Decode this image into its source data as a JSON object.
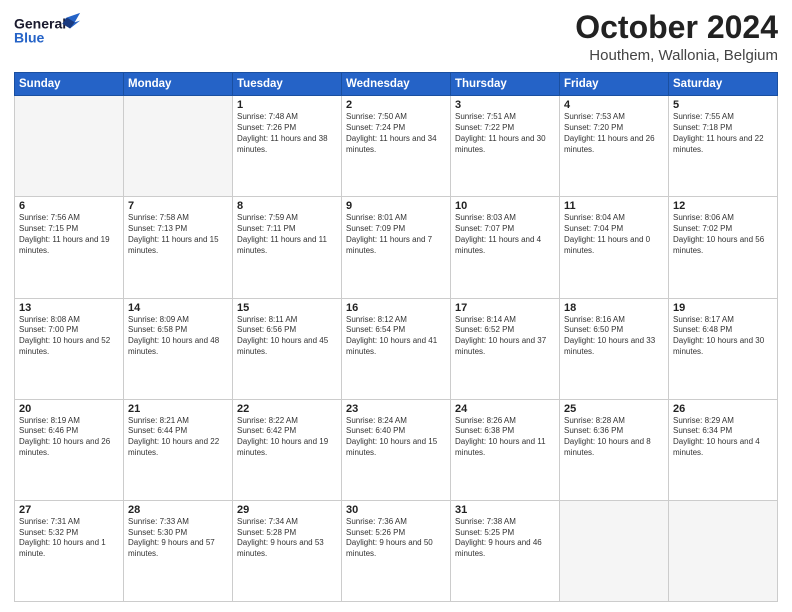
{
  "header": {
    "logo_line1": "General",
    "logo_line2": "Blue",
    "month": "October 2024",
    "location": "Houthem, Wallonia, Belgium"
  },
  "days_of_week": [
    "Sunday",
    "Monday",
    "Tuesday",
    "Wednesday",
    "Thursday",
    "Friday",
    "Saturday"
  ],
  "weeks": [
    [
      {
        "day": "",
        "text": ""
      },
      {
        "day": "",
        "text": ""
      },
      {
        "day": "1",
        "text": "Sunrise: 7:48 AM\nSunset: 7:26 PM\nDaylight: 11 hours and 38 minutes."
      },
      {
        "day": "2",
        "text": "Sunrise: 7:50 AM\nSunset: 7:24 PM\nDaylight: 11 hours and 34 minutes."
      },
      {
        "day": "3",
        "text": "Sunrise: 7:51 AM\nSunset: 7:22 PM\nDaylight: 11 hours and 30 minutes."
      },
      {
        "day": "4",
        "text": "Sunrise: 7:53 AM\nSunset: 7:20 PM\nDaylight: 11 hours and 26 minutes."
      },
      {
        "day": "5",
        "text": "Sunrise: 7:55 AM\nSunset: 7:18 PM\nDaylight: 11 hours and 22 minutes."
      }
    ],
    [
      {
        "day": "6",
        "text": "Sunrise: 7:56 AM\nSunset: 7:15 PM\nDaylight: 11 hours and 19 minutes."
      },
      {
        "day": "7",
        "text": "Sunrise: 7:58 AM\nSunset: 7:13 PM\nDaylight: 11 hours and 15 minutes."
      },
      {
        "day": "8",
        "text": "Sunrise: 7:59 AM\nSunset: 7:11 PM\nDaylight: 11 hours and 11 minutes."
      },
      {
        "day": "9",
        "text": "Sunrise: 8:01 AM\nSunset: 7:09 PM\nDaylight: 11 hours and 7 minutes."
      },
      {
        "day": "10",
        "text": "Sunrise: 8:03 AM\nSunset: 7:07 PM\nDaylight: 11 hours and 4 minutes."
      },
      {
        "day": "11",
        "text": "Sunrise: 8:04 AM\nSunset: 7:04 PM\nDaylight: 11 hours and 0 minutes."
      },
      {
        "day": "12",
        "text": "Sunrise: 8:06 AM\nSunset: 7:02 PM\nDaylight: 10 hours and 56 minutes."
      }
    ],
    [
      {
        "day": "13",
        "text": "Sunrise: 8:08 AM\nSunset: 7:00 PM\nDaylight: 10 hours and 52 minutes."
      },
      {
        "day": "14",
        "text": "Sunrise: 8:09 AM\nSunset: 6:58 PM\nDaylight: 10 hours and 48 minutes."
      },
      {
        "day": "15",
        "text": "Sunrise: 8:11 AM\nSunset: 6:56 PM\nDaylight: 10 hours and 45 minutes."
      },
      {
        "day": "16",
        "text": "Sunrise: 8:12 AM\nSunset: 6:54 PM\nDaylight: 10 hours and 41 minutes."
      },
      {
        "day": "17",
        "text": "Sunrise: 8:14 AM\nSunset: 6:52 PM\nDaylight: 10 hours and 37 minutes."
      },
      {
        "day": "18",
        "text": "Sunrise: 8:16 AM\nSunset: 6:50 PM\nDaylight: 10 hours and 33 minutes."
      },
      {
        "day": "19",
        "text": "Sunrise: 8:17 AM\nSunset: 6:48 PM\nDaylight: 10 hours and 30 minutes."
      }
    ],
    [
      {
        "day": "20",
        "text": "Sunrise: 8:19 AM\nSunset: 6:46 PM\nDaylight: 10 hours and 26 minutes."
      },
      {
        "day": "21",
        "text": "Sunrise: 8:21 AM\nSunset: 6:44 PM\nDaylight: 10 hours and 22 minutes."
      },
      {
        "day": "22",
        "text": "Sunrise: 8:22 AM\nSunset: 6:42 PM\nDaylight: 10 hours and 19 minutes."
      },
      {
        "day": "23",
        "text": "Sunrise: 8:24 AM\nSunset: 6:40 PM\nDaylight: 10 hours and 15 minutes."
      },
      {
        "day": "24",
        "text": "Sunrise: 8:26 AM\nSunset: 6:38 PM\nDaylight: 10 hours and 11 minutes."
      },
      {
        "day": "25",
        "text": "Sunrise: 8:28 AM\nSunset: 6:36 PM\nDaylight: 10 hours and 8 minutes."
      },
      {
        "day": "26",
        "text": "Sunrise: 8:29 AM\nSunset: 6:34 PM\nDaylight: 10 hours and 4 minutes."
      }
    ],
    [
      {
        "day": "27",
        "text": "Sunrise: 7:31 AM\nSunset: 5:32 PM\nDaylight: 10 hours and 1 minute."
      },
      {
        "day": "28",
        "text": "Sunrise: 7:33 AM\nSunset: 5:30 PM\nDaylight: 9 hours and 57 minutes."
      },
      {
        "day": "29",
        "text": "Sunrise: 7:34 AM\nSunset: 5:28 PM\nDaylight: 9 hours and 53 minutes."
      },
      {
        "day": "30",
        "text": "Sunrise: 7:36 AM\nSunset: 5:26 PM\nDaylight: 9 hours and 50 minutes."
      },
      {
        "day": "31",
        "text": "Sunrise: 7:38 AM\nSunset: 5:25 PM\nDaylight: 9 hours and 46 minutes."
      },
      {
        "day": "",
        "text": ""
      },
      {
        "day": "",
        "text": ""
      }
    ]
  ]
}
